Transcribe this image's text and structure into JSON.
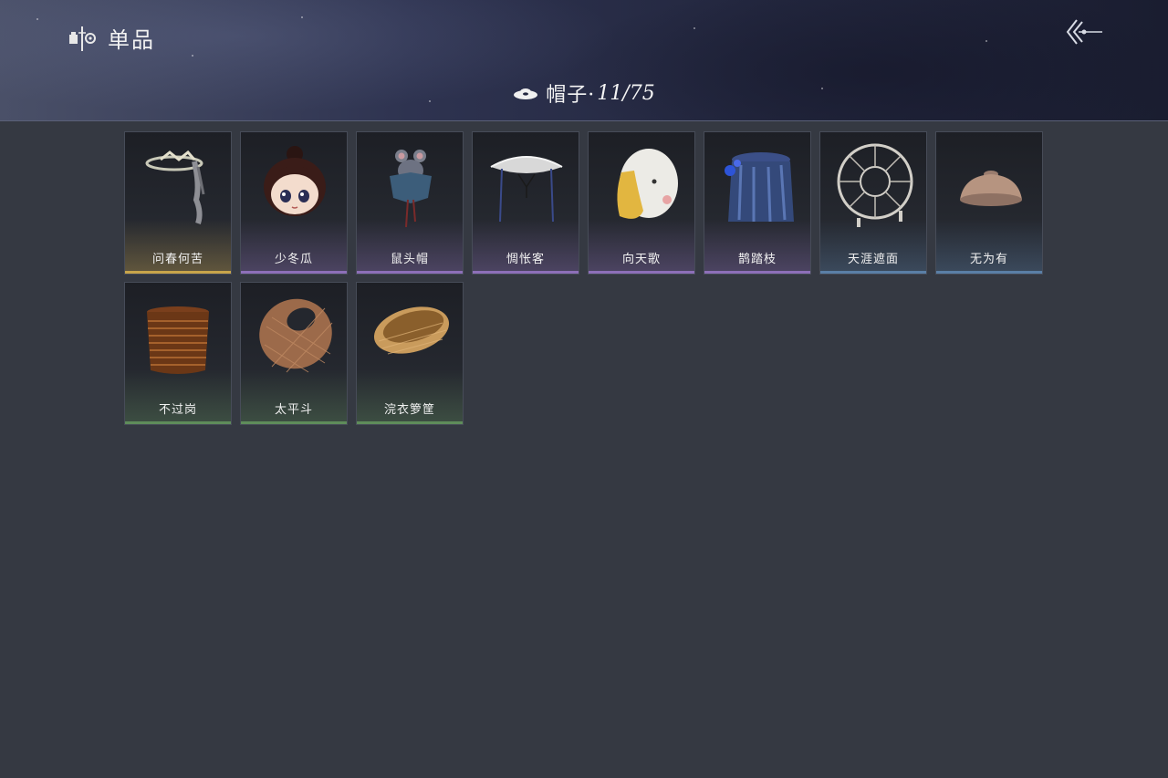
{
  "header": {
    "title": "单品",
    "brand_icon": "brand-emblem-icon",
    "back_icon": "back-arrows-icon"
  },
  "category": {
    "icon": "hat-icon",
    "label": "帽子·",
    "count": "11/75"
  },
  "items": [
    {
      "name": "问春何苦",
      "rarity": "gold",
      "icon": "ribbon-hat-icon"
    },
    {
      "name": "少冬瓜",
      "rarity": "purple",
      "icon": "chibi-head-icon"
    },
    {
      "name": "鼠头帽",
      "rarity": "purple",
      "icon": "mouse-hood-icon"
    },
    {
      "name": "惆怅客",
      "rarity": "purple",
      "icon": "veil-hat-icon"
    },
    {
      "name": "向天歌",
      "rarity": "purple",
      "icon": "goose-hood-icon"
    },
    {
      "name": "鹊踏枝",
      "rarity": "purple",
      "icon": "blue-veil-icon"
    },
    {
      "name": "天涯遮面",
      "rarity": "blue",
      "icon": "wheel-hat-icon"
    },
    {
      "name": "无为有",
      "rarity": "blue",
      "icon": "bowl-hat-icon"
    },
    {
      "name": "不过岗",
      "rarity": "green",
      "icon": "stacked-bowls-icon"
    },
    {
      "name": "太平斗",
      "rarity": "green",
      "icon": "woven-basket-icon"
    },
    {
      "name": "浣衣箩筐",
      "rarity": "green",
      "icon": "laundry-basket-icon"
    }
  ],
  "colors": {
    "gold": "#c9a54a",
    "purple": "#8d6fb8",
    "blue": "#5a7fa6",
    "green": "#5f8c5a"
  }
}
